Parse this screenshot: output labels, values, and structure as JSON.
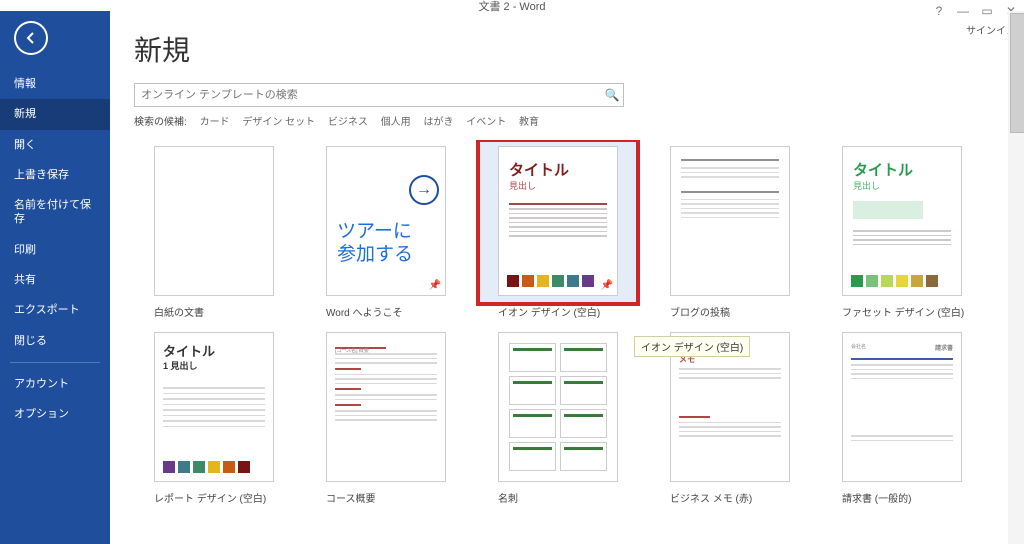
{
  "window": {
    "title": "文書 2 - Word",
    "signin": "サインイン"
  },
  "sidebar": {
    "items": [
      "情報",
      "新規",
      "開く",
      "上書き保存",
      "名前を付けて保存",
      "印刷",
      "共有",
      "エクスポート",
      "閉じる"
    ],
    "extra": [
      "アカウント",
      "オプション"
    ],
    "selected_index": 1
  },
  "page": {
    "heading": "新規",
    "search_placeholder": "オンライン テンプレートの検索",
    "suggest_label": "検索の候補:",
    "suggestions": [
      "カード",
      "デザイン セット",
      "ビジネス",
      "個人用",
      "はがき",
      "イベント",
      "教育"
    ]
  },
  "templates_row1": [
    {
      "id": "blank",
      "caption": "白紙の文書"
    },
    {
      "id": "tour",
      "caption": "Word へようこそ",
      "tour_line1": "ツアーに",
      "tour_line2": "参加する"
    },
    {
      "id": "ion",
      "caption": "イオン デザイン (空白)",
      "title": "タイトル",
      "sub": "見出し",
      "swatches": [
        "#7a1313",
        "#c95a16",
        "#e6b41f",
        "#3f8a66",
        "#3f7a8a",
        "#6a3a8a"
      ],
      "selected": true
    },
    {
      "id": "blog",
      "caption": "ブログの投稿"
    },
    {
      "id": "facet",
      "caption": "ファセット デザイン (空白)",
      "title": "タイトル",
      "sub": "見出し",
      "swatches": [
        "#2a9b4d",
        "#7ac17a",
        "#b7d95a",
        "#e6d43a",
        "#c9a53a",
        "#8a6a3a"
      ]
    }
  ],
  "templates_row2": [
    {
      "id": "report",
      "caption": "レポート デザイン (空白)",
      "title": "タイトル",
      "sub": "1 見出し",
      "swatches": [
        "#6a3a8a",
        "#3f7a8a",
        "#3f8a66",
        "#e6b41f",
        "#c95a16",
        "#7a1313"
      ]
    },
    {
      "id": "course",
      "caption": "コース概要",
      "heading": "[コース名] 概要"
    },
    {
      "id": "meishi",
      "caption": "名刺"
    },
    {
      "id": "memo",
      "caption": "ビジネス メモ (赤)",
      "memo_label": "[会社名]"
    },
    {
      "id": "invoice",
      "caption": "請求書 (一般的)"
    }
  ],
  "tooltip": "イオン デザイン (空白)"
}
